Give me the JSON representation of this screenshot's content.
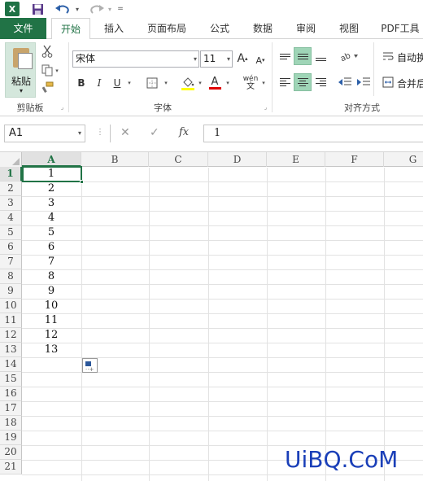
{
  "app": {
    "logo_text": "X"
  },
  "quick_access": {
    "undo_dropdown": "▾",
    "redo_dropdown": "▾",
    "customize": "="
  },
  "tabs": [
    {
      "label": "文件"
    },
    {
      "label": "开始"
    },
    {
      "label": "插入"
    },
    {
      "label": "页面布局"
    },
    {
      "label": "公式"
    },
    {
      "label": "数据"
    },
    {
      "label": "审阅"
    },
    {
      "label": "视图"
    },
    {
      "label": "PDF工具"
    }
  ],
  "clipboard": {
    "paste_label": "粘贴",
    "group_label": "剪贴板"
  },
  "font": {
    "font_name": "宋体",
    "font_size": "11",
    "grow_label": "A",
    "shrink_label": "A",
    "bold_label": "B",
    "italic_label": "I",
    "underline_label": "U",
    "font_color_label": "A",
    "phonetic_label": "wén",
    "group_label": "字体"
  },
  "alignment": {
    "wrap_text_label": "自动换",
    "merge_label": "合并后",
    "group_label": "对齐方式"
  },
  "formula_bar": {
    "name_box": "A1",
    "cancel_symbol": "✕",
    "enter_symbol": "✓",
    "fx_label": "fx",
    "value": "1"
  },
  "sheet": {
    "columns": [
      "A",
      "B",
      "C",
      "D",
      "E",
      "F",
      "G"
    ],
    "rows": [
      "1",
      "2",
      "3",
      "4",
      "5",
      "6",
      "7",
      "8",
      "9",
      "10",
      "11",
      "12",
      "13",
      "14",
      "15",
      "16",
      "17",
      "18",
      "19",
      "20",
      "21"
    ],
    "colA_values": [
      "1",
      "2",
      "3",
      "4",
      "5",
      "6",
      "7",
      "8",
      "9",
      "10",
      "11",
      "12",
      "13"
    ]
  },
  "colors": {
    "excel_green": "#217346",
    "selected_button": "#9fd5b7",
    "watermark_blue": "#1a3fb8"
  },
  "watermark": "UiBQ.CoM"
}
